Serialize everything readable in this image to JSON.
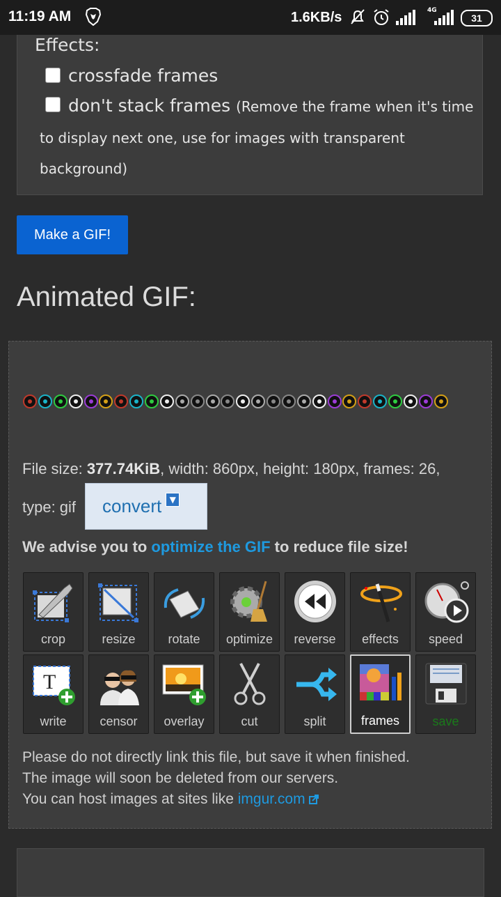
{
  "status_bar": {
    "time": "11:19 AM",
    "net_speed": "1.6KB/s",
    "network_type": "4G",
    "battery": "31",
    "icons": [
      "brave-icon",
      "mute-icon",
      "alarm-icon",
      "signal-icon",
      "signal-4g-icon",
      "battery-icon"
    ]
  },
  "effects": {
    "title": "Effects:",
    "crossfade_label": "crossfade frames",
    "nostack_label": "don't stack frames",
    "nostack_note_1": "(Remove the frame when it's time",
    "nostack_note_2": "to display next one, use for images with transparent",
    "nostack_note_3": "background)"
  },
  "make_gif_button": "Make a GIF!",
  "animated_title": "Animated GIF:",
  "gif_preview": {
    "frame_colors": [
      "#c0392b",
      "#1ab3c8",
      "#2ecc40",
      "#eeeeee",
      "#9b3bd6",
      "#d4a017",
      "#c0392b",
      "#1ab3c8",
      "#2ecc40",
      "#eeeeee",
      "#aaaaaa",
      "#888888",
      "#aaaaaa",
      "#888888",
      "#eeeeee",
      "#aaaaaa",
      "#888888",
      "#888888",
      "#aaaaaa",
      "#eeeeee",
      "#9b3bd6",
      "#d4a017",
      "#c0392b",
      "#1ab3c8",
      "#2ecc40",
      "#eeeeee",
      "#9b3bd6",
      "#d4a017"
    ]
  },
  "file_info": {
    "size_label": "File size: ",
    "size_value": "377.74KiB",
    "rest": ", width: 860px, height: 180px, frames: 26,",
    "type_label": "type: gif",
    "convert_label": "convert"
  },
  "advise": {
    "prefix": "We advise you to ",
    "link": "optimize the GIF",
    "suffix": " to reduce file size!"
  },
  "tools": [
    {
      "label": "crop"
    },
    {
      "label": "resize"
    },
    {
      "label": "rotate"
    },
    {
      "label": "optimize"
    },
    {
      "label": "reverse"
    },
    {
      "label": "effects"
    },
    {
      "label": "speed"
    },
    {
      "label": "write"
    },
    {
      "label": "censor"
    },
    {
      "label": "overlay"
    },
    {
      "label": "cut"
    },
    {
      "label": "split"
    },
    {
      "label": "frames"
    },
    {
      "label": "save"
    }
  ],
  "footnote": {
    "line1": "Please do not directly link this file, but save it when finished.",
    "line2": "The image will soon be deleted from our servers.",
    "line3_prefix": "You can host images at sites like ",
    "line3_link": "imgur.com"
  }
}
